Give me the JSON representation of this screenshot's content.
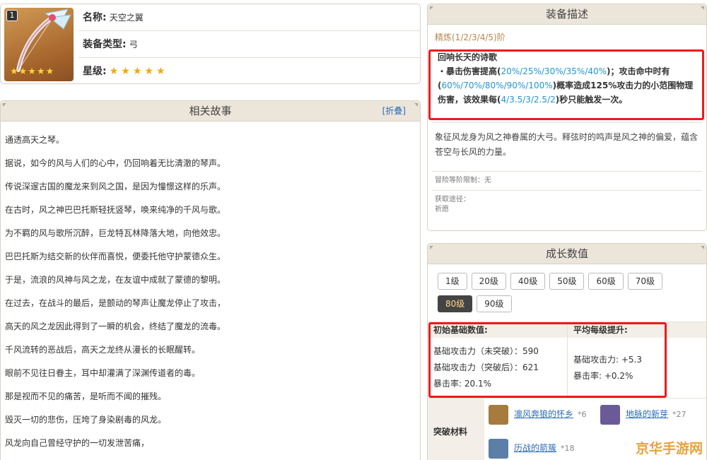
{
  "info": {
    "level_badge": "1",
    "name_label": "名称:",
    "name_value": "天空之翼",
    "type_label": "装备类型:",
    "type_value": "弓",
    "star_label": "星级:",
    "stars": "★★★★★",
    "thumb_stars": "★★★★★"
  },
  "story": {
    "title": "相关故事",
    "fold": "[折叠]",
    "lines": [
      "通透高天之琴。",
      "据说，如今的风与人们的心中，仍回响着无比清澈的琴声。",
      "传说深邃古国的魔龙来到风之国，是因为憧憬这样的乐声。",
      "在古时，风之神巴巴托斯轻抚竖琴，唤来纯净的千风与歌。",
      "为不羁的风与歌所沉醉，巨龙特瓦林降落大地，向他效忠。",
      "巴巴托斯为结交新的伙伴而喜悦，便委托他守护蒙德众生。",
      "于是，流浪的风神与风之龙，在友谊中成就了蒙德的黎明。",
      "在过去，在战斗的最后，是颤动的琴声让魔龙停止了攻击，",
      "高天的风之龙因此得到了一瞬的机会，终结了魔龙的流毒。",
      "千风流转的恶战后，高天之龙终从漫长的长眠醒转。",
      "眼前不见往日眷主，耳中却灌满了深渊传道者的毒。",
      "那是视而不见的痛苦，是听而不闻的摧残。",
      "毁灭一切的悲伤，压垮了身染剧毒的风龙。",
      "风龙向自己曾经守护的一切发泄苦痛，"
    ]
  },
  "desc": {
    "title": "装备描述",
    "refine": "精炼(1/2/3/4/5)阶",
    "effect_title": "回响长天的诗歌",
    "e1": "・暴击伤害提高(",
    "e1v": "20%/25%/30%/35%/40%",
    "e2": ")；攻击命中时有(",
    "e2v": "60%/70%/80%/90%/100%",
    "e3": ")概率造成125%攻击力的小范围物理伤害，该效果每(",
    "e3v": "4/3.5/3/2.5/2",
    "e4": ")秒只能触发一次。",
    "flavor": "象征风龙身为风之神眷属的大弓。释弦时的鸣声是风之神的偏爱，蕴含苍空与长风的力量。",
    "limit": "冒险等阶限制：无",
    "obtain_label": "获取途径：",
    "obtain_value": "祈愿"
  },
  "growth": {
    "title": "成长数值",
    "levels": [
      "1级",
      "20级",
      "40级",
      "50级",
      "60级",
      "70级",
      "80级",
      "90级"
    ],
    "active_level": "80级",
    "base_title": "初始基础数值:",
    "base_lines": [
      "基础攻击力（未突破）：590",
      "基础攻击力（突破后）：621",
      "暴击率: 20.1%"
    ],
    "avg_title": "平均每级提升:",
    "avg_lines": [
      "基础攻击力: +5.3",
      "暴击率: +0.2%"
    ],
    "materials_label": "突破材料",
    "materials": [
      {
        "name": "凛风奔狼的怀乡",
        "qty": "*6",
        "color": "#a77b3e"
      },
      {
        "name": "地脉的新芽",
        "qty": "*27",
        "color": "#6b5a98"
      },
      {
        "name": "历战的箭簇",
        "qty": "*18",
        "color": "#5b7fa6"
      }
    ]
  },
  "watermark": "京华手游网",
  "colors": {
    "accent_red": "#ee1a1a",
    "highlight_blue": "#2196d3",
    "header_bg": "#ece5da"
  }
}
